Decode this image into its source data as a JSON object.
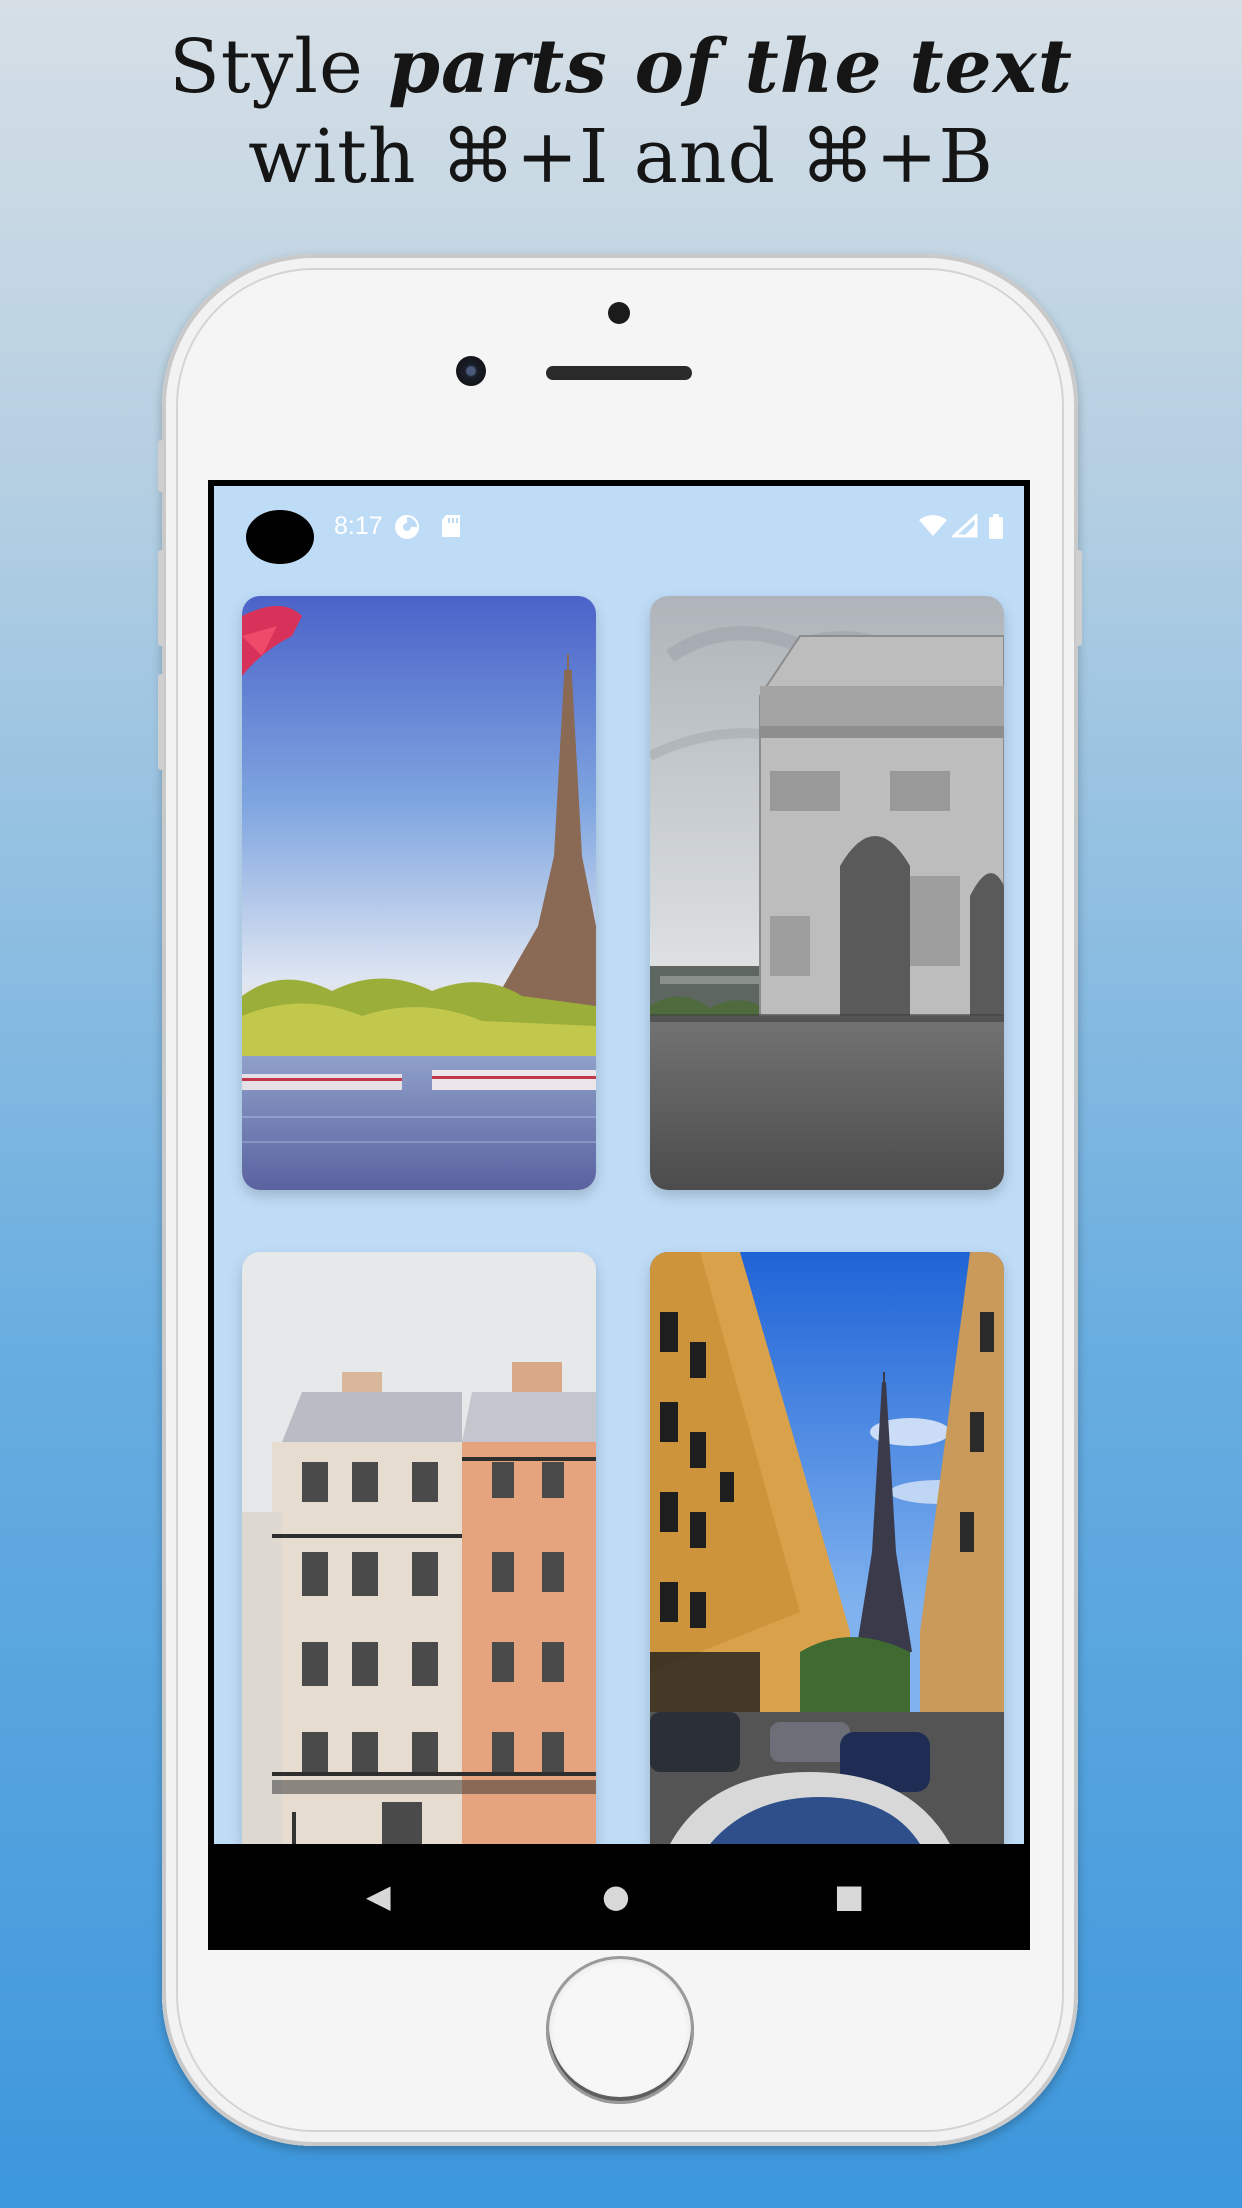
{
  "headline": {
    "line1_plain": "Style ",
    "line1_emphasis": "parts of the text",
    "line2": "with ⌘+I and ⌘+B"
  },
  "status_bar": {
    "time": "8:17",
    "icons": [
      "camera-cutout",
      "data-saver-icon",
      "sd-card-icon",
      "wifi-icon",
      "signal-icon",
      "battery-icon"
    ]
  },
  "gallery": {
    "images": [
      {
        "subject": "eiffel-tower-seine"
      },
      {
        "subject": "arc-de-triomphe"
      },
      {
        "subject": "paris-building-facade"
      },
      {
        "subject": "paris-street-eiffel-view"
      }
    ]
  },
  "nav_bar": {
    "back": "◀",
    "home": "●",
    "recents": "■"
  },
  "colors": {
    "display_background": "#bfdcf7",
    "page_gradient_top": "#d6dfe6",
    "page_gradient_bottom": "#3d97dc",
    "phone_body": "#f5f5f5"
  }
}
